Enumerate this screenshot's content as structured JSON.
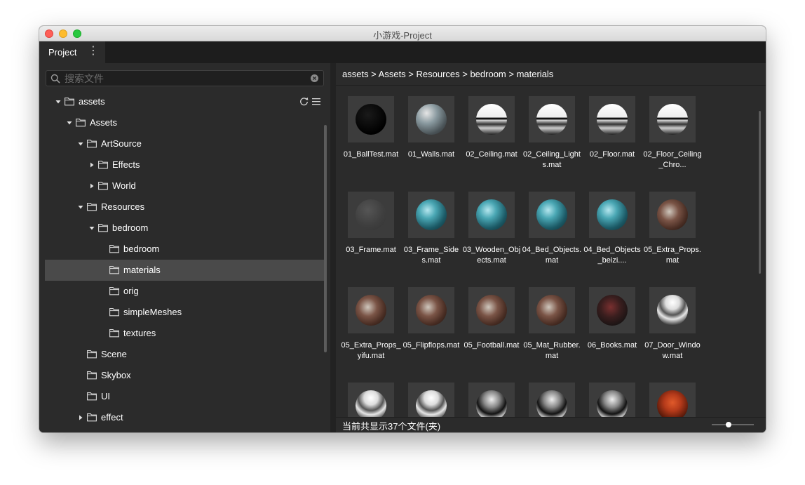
{
  "window": {
    "title": "小游戏-Project"
  },
  "tab": {
    "label": "Project",
    "menu_glyph": "⋮"
  },
  "search": {
    "placeholder": "搜索文件",
    "value": ""
  },
  "tree": [
    {
      "label": "assets",
      "depth": 0,
      "arrow": "expanded",
      "tools": true
    },
    {
      "label": "Assets",
      "depth": 1,
      "arrow": "expanded"
    },
    {
      "label": "ArtSource",
      "depth": 2,
      "arrow": "expanded"
    },
    {
      "label": "Effects",
      "depth": 3,
      "arrow": "collapsed"
    },
    {
      "label": "World",
      "depth": 3,
      "arrow": "collapsed"
    },
    {
      "label": "Resources",
      "depth": 2,
      "arrow": "expanded"
    },
    {
      "label": "bedroom",
      "depth": 3,
      "arrow": "expanded"
    },
    {
      "label": "bedroom",
      "depth": 4,
      "arrow": "none"
    },
    {
      "label": "materials",
      "depth": 4,
      "arrow": "none",
      "selected": true
    },
    {
      "label": "orig",
      "depth": 4,
      "arrow": "none"
    },
    {
      "label": "simpleMeshes",
      "depth": 4,
      "arrow": "none"
    },
    {
      "label": "textures",
      "depth": 4,
      "arrow": "none"
    },
    {
      "label": "Scene",
      "depth": 2,
      "arrow": "none"
    },
    {
      "label": "Skybox",
      "depth": 2,
      "arrow": "none"
    },
    {
      "label": "UI",
      "depth": 2,
      "arrow": "none"
    },
    {
      "label": "effect",
      "depth": 2,
      "arrow": "collapsed"
    }
  ],
  "breadcrumb": "assets > Assets > Resources > bedroom > materials",
  "files": [
    {
      "label": "01_BallTest.mat",
      "swatch": "dark"
    },
    {
      "label": "01_Walls.mat",
      "swatch": "wall"
    },
    {
      "label": "02_Ceiling.mat",
      "swatch": "ceiling"
    },
    {
      "label": "02_Ceiling_Lights.mat",
      "swatch": "ceiling"
    },
    {
      "label": "02_Floor.mat",
      "swatch": "ceiling"
    },
    {
      "label": "02_Floor_Ceiling_Chro...",
      "swatch": "ceiling"
    },
    {
      "label": "03_Frame.mat",
      "swatch": "frame"
    },
    {
      "label": "03_Frame_Sides.mat",
      "swatch": "teal"
    },
    {
      "label": "03_Wooden_Objects.mat",
      "swatch": "teal"
    },
    {
      "label": "04_Bed_Objects.mat",
      "swatch": "teal"
    },
    {
      "label": "04_Bed_Objects_beizi....",
      "swatch": "teal"
    },
    {
      "label": "05_Extra_Props.mat",
      "swatch": "wood"
    },
    {
      "label": "05_Extra_Props_yifu.mat",
      "swatch": "wood"
    },
    {
      "label": "05_Flipflops.mat",
      "swatch": "wood"
    },
    {
      "label": "05_Football.mat",
      "swatch": "wood"
    },
    {
      "label": "05_Mat_Rubber.mat",
      "swatch": "wood"
    },
    {
      "label": "06_Books.mat",
      "swatch": "books"
    },
    {
      "label": "07_Door_Window.mat",
      "swatch": "chrome"
    },
    {
      "label": "",
      "swatch": "chrome"
    },
    {
      "label": "",
      "swatch": "chrome"
    },
    {
      "label": "",
      "swatch": "metal"
    },
    {
      "label": "",
      "swatch": "metal"
    },
    {
      "label": "",
      "swatch": "metal"
    },
    {
      "label": "",
      "swatch": "sign"
    }
  ],
  "status": {
    "text": "当前共显示37个文件(夹)",
    "zoom_fraction": 0.4
  },
  "colors": {
    "background": "#2b2b2b",
    "selected_row": "#4a4a4a",
    "thumb_bg": "#3c3c3c",
    "divider": "#222222"
  }
}
